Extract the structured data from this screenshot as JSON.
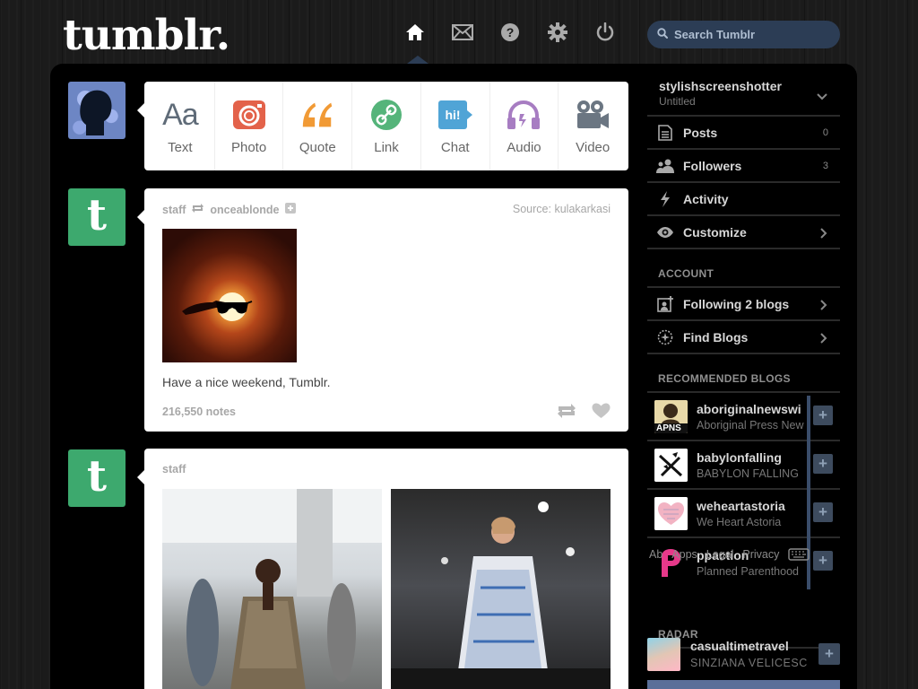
{
  "header": {
    "logo_text": "tumblr.",
    "nav_icons": [
      "home-icon",
      "mail-icon",
      "help-icon",
      "gear-icon",
      "power-icon"
    ],
    "search_placeholder": "Search Tumblr"
  },
  "composer": {
    "types": [
      {
        "label": "Text",
        "icon": "text-icon",
        "glyph": "Aa",
        "color": "#5f6b78"
      },
      {
        "label": "Photo",
        "icon": "camera-icon",
        "color": "#e3624a"
      },
      {
        "label": "Quote",
        "icon": "quote-icon",
        "color": "#f19a35"
      },
      {
        "label": "Link",
        "icon": "link-icon",
        "color": "#55b47a"
      },
      {
        "label": "Chat",
        "icon": "chat-icon",
        "glyph": "hi!",
        "color": "#50a4d6"
      },
      {
        "label": "Audio",
        "icon": "headphones-icon",
        "color": "#a77dc2"
      },
      {
        "label": "Video",
        "icon": "video-camera-icon",
        "color": "#6b7682"
      }
    ]
  },
  "posts": [
    {
      "author": "staff",
      "reblogged_from": "onceablonde",
      "source_label": "Source:",
      "source": "kulakarkasi",
      "caption": "Have a nice weekend, Tumblr.",
      "notes": "216,550 notes"
    },
    {
      "author": "staff"
    }
  ],
  "sidebar": {
    "blog": {
      "name": "stylishscreenshotter",
      "subtitle": "Untitled"
    },
    "items": [
      {
        "label": "Posts",
        "count": "0",
        "icon": "document-icon"
      },
      {
        "label": "Followers",
        "count": "3",
        "icon": "people-icon"
      },
      {
        "label": "Activity",
        "count": "",
        "icon": "lightning-icon"
      },
      {
        "label": "Customize",
        "count": "",
        "icon": "eye-icon"
      }
    ],
    "account_title": "ACCOUNT",
    "account_items": [
      {
        "label": "Following 2 blogs",
        "icon": "add-person-icon"
      },
      {
        "label": "Find Blogs",
        "icon": "compass-icon"
      }
    ],
    "recommended_title": "RECOMMENDED BLOGS",
    "recommended": [
      {
        "name": "aboriginalnewswi",
        "subtitle": "Aboriginal Press New",
        "badge": "APNS"
      },
      {
        "name": "babylonfalling",
        "subtitle": "BABYLON FALLING"
      },
      {
        "name": "weheartastoria",
        "subtitle": "We Heart Astoria"
      },
      {
        "name": "ppaction",
        "subtitle": "Planned Parenthood"
      }
    ],
    "footer_links": [
      "Ab",
      "Apps",
      "Legal",
      "Privacy"
    ],
    "radar_title": "RADAR",
    "radar": {
      "name": "casualtimetravel",
      "subtitle": "SINZIANA VELICESC"
    }
  },
  "colors": {
    "accent": "#2c3d55",
    "staff_avatar": "#3da96e"
  }
}
